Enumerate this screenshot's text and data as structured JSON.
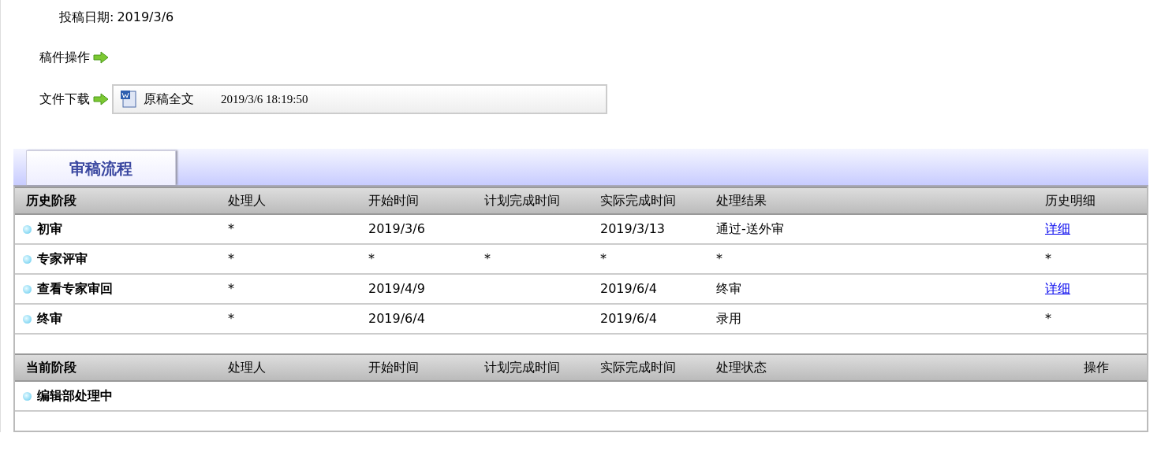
{
  "submission": {
    "label": "投稿日期:",
    "date": "2019/3/6"
  },
  "manuscript_actions": {
    "label": "稿件操作"
  },
  "file_download": {
    "label": "文件下载",
    "file_name": "原稿全文",
    "timestamp": "2019/3/6 18:19:50"
  },
  "tabs": [
    {
      "label": "审稿流程",
      "selected": true
    }
  ],
  "history": {
    "columns": [
      "历史阶段",
      "处理人",
      "开始时间",
      "计划完成时间",
      "实际完成时间",
      "处理结果",
      "历史明细"
    ],
    "rows": [
      {
        "stage": "初审",
        "handler": "*",
        "start": "2019/3/6",
        "planned": "",
        "actual": "2019/3/13",
        "result": "通过-送外审",
        "detail": {
          "text": "详细",
          "link": true
        }
      },
      {
        "stage": "专家评审",
        "handler": "*",
        "start": "*",
        "planned": "*",
        "actual": "*",
        "result": "*",
        "detail": {
          "text": "*",
          "link": false
        }
      },
      {
        "stage": "查看专家审回",
        "handler": "*",
        "start": "2019/4/9",
        "planned": "",
        "actual": "2019/6/4",
        "result": "终审",
        "detail": {
          "text": "详细",
          "link": true
        }
      },
      {
        "stage": "终审",
        "handler": "*",
        "start": "2019/6/4",
        "planned": "",
        "actual": "2019/6/4",
        "result": "录用",
        "detail": {
          "text": "*",
          "link": false
        }
      }
    ]
  },
  "current": {
    "columns": [
      "当前阶段",
      "处理人",
      "开始时间",
      "计划完成时间",
      "实际完成时间",
      "处理状态",
      "操作"
    ],
    "rows": [
      {
        "stage": "编辑部处理中"
      }
    ]
  }
}
